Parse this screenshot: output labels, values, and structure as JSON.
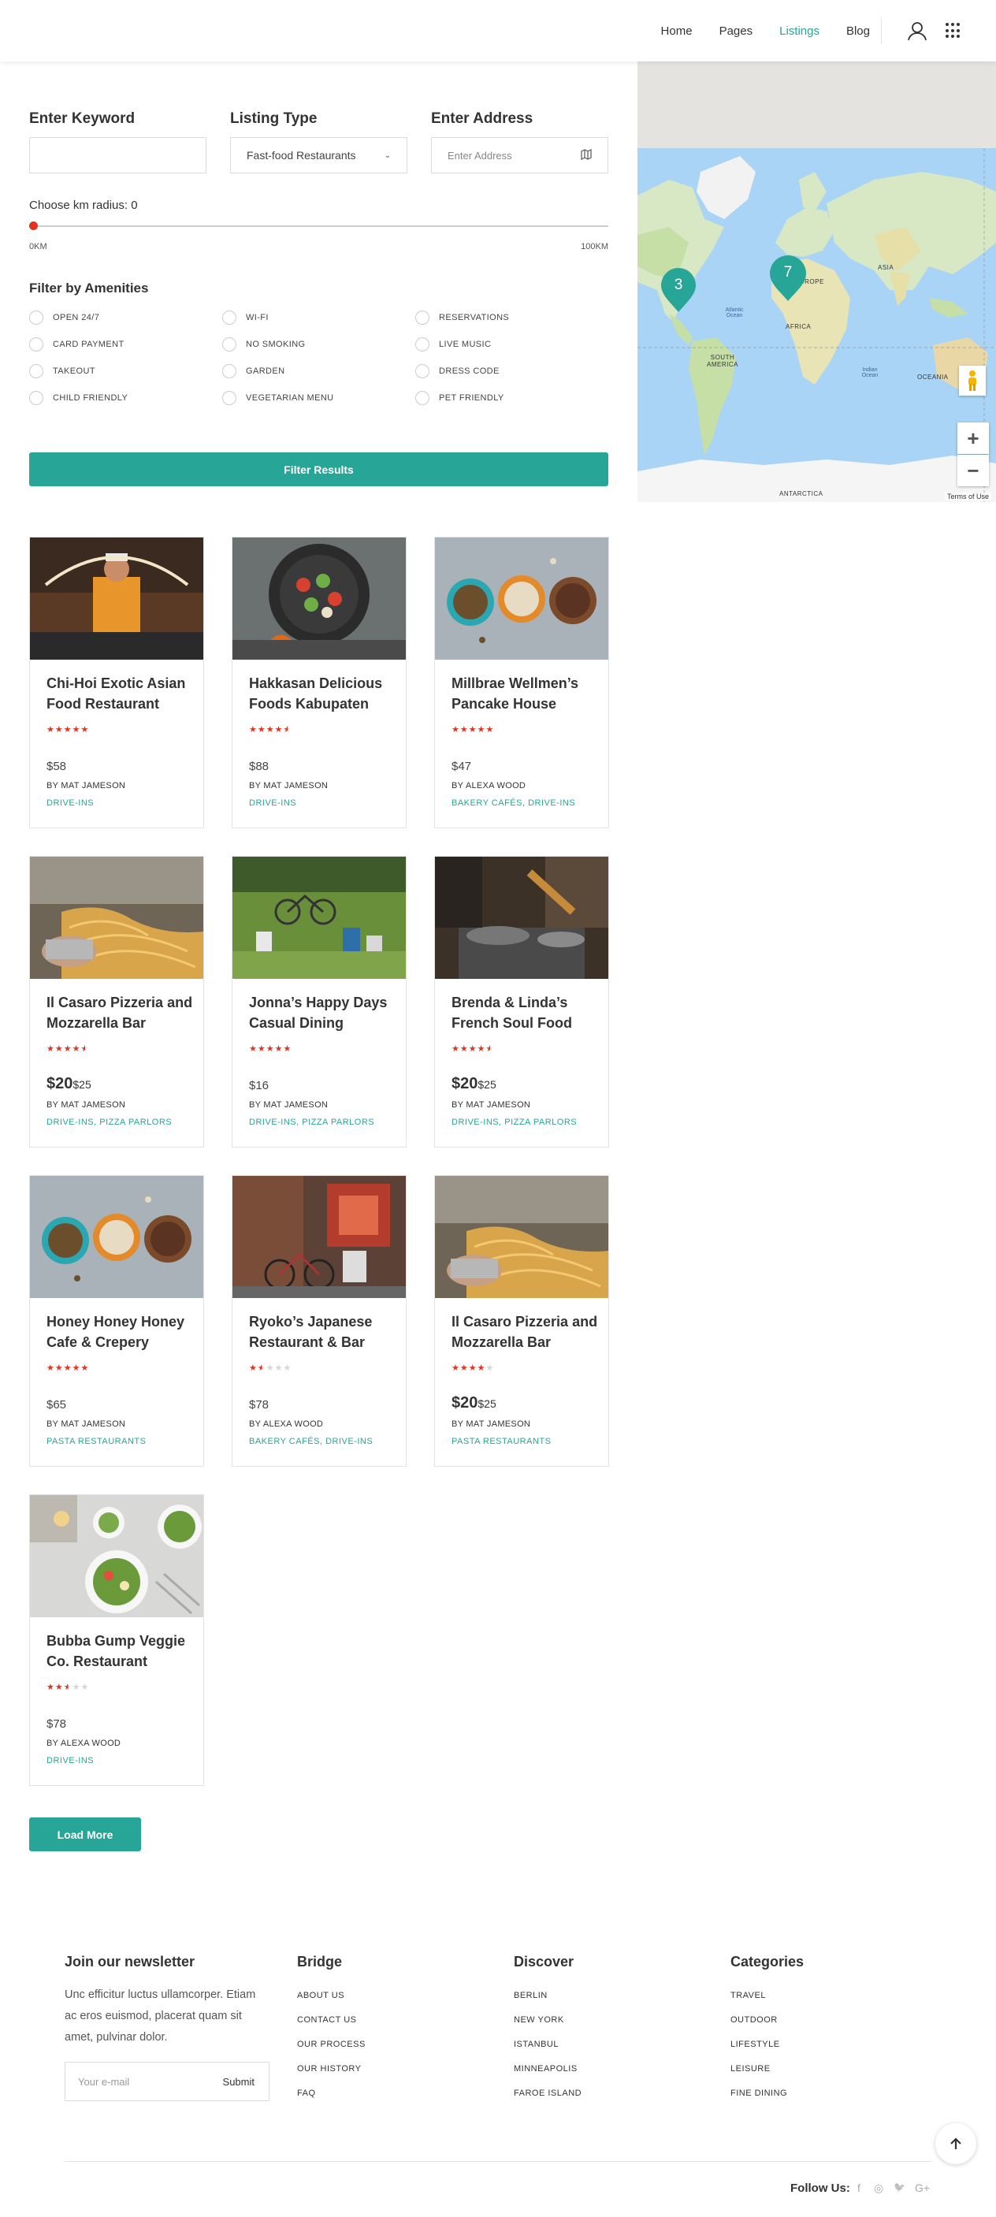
{
  "nav": {
    "items": [
      "Home",
      "Pages",
      "Listings",
      "Blog"
    ],
    "active": "Listings"
  },
  "filters": {
    "keyword_label": "Enter Keyword",
    "keyword_value": "",
    "type_label": "Listing Type",
    "type_value": "Fast-food Restaurants",
    "address_label": "Enter Address",
    "address_placeholder": "Enter Address",
    "radius_label": "Choose km radius: 0",
    "radius_value": 0,
    "radius_min": "0KM",
    "radius_max": "100KM",
    "amenities_title": "Filter by Amenities",
    "amenities": [
      "OPEN 24/7",
      "WI-FI",
      "RESERVATIONS",
      "CARD PAYMENT",
      "NO SMOKING",
      "LIVE MUSIC",
      "TAKEOUT",
      "GARDEN",
      "DRESS CODE",
      "CHILD FRIENDLY",
      "VEGETARIAN MENU",
      "PET FRIENDLY"
    ],
    "submit_label": "Filter Results"
  },
  "map": {
    "clusters": [
      "3",
      "7"
    ],
    "continents": [
      "ASIA",
      "EUROPE",
      "AFRICA",
      "SOUTH AMERICA",
      "OCEANIA",
      "ANTARCTICA"
    ],
    "oceans": [
      "Atlantic Ocean",
      "Indian Ocean"
    ],
    "zoom_in": "+",
    "zoom_out": "−",
    "terms": "Terms of Use"
  },
  "listings": [
    {
      "title": "Chi-Hoi Exotic Asian Food Restaurant",
      "rating": 5,
      "price": "$58",
      "price_sub": "",
      "author": "BY MAT JAMESON",
      "tags": "DRIVE-INS",
      "image": "chef"
    },
    {
      "title": "Hakkasan Delicious Foods Kabupaten",
      "rating": 4.5,
      "price": "$88",
      "price_sub": "",
      "author": "BY MAT JAMESON",
      "tags": "DRIVE-INS",
      "image": "pan"
    },
    {
      "title": "Millbrae Wellmen’s Pancake House",
      "rating": 5,
      "price": "$47",
      "price_sub": "",
      "author": "BY ALEXA WOOD",
      "tags": "BAKERY CAFÉS, DRIVE-INS",
      "image": "bowls"
    },
    {
      "title": "Il Casaro Pizzeria and Mozzarella Bar",
      "rating": 4.5,
      "price": "$20",
      "price_sub": "$25",
      "author": "BY MAT JAMESON",
      "tags": "DRIVE-INS, PIZZA PARLORS",
      "image": "noodles"
    },
    {
      "title": "Jonna’s Happy Days Casual Dining",
      "rating": 5,
      "price": "$16",
      "price_sub": "",
      "author": "BY MAT JAMESON",
      "tags": "DRIVE-INS, PIZZA PARLORS",
      "image": "park"
    },
    {
      "title": "Brenda & Linda’s French Soul Food",
      "rating": 4.5,
      "price": "$20",
      "price_sub": "$25",
      "author": "BY MAT JAMESON",
      "tags": "DRIVE-INS, PIZZA PARLORS",
      "image": "cook"
    },
    {
      "title": "Honey Honey Honey Cafe & Crepery",
      "rating": 5,
      "price": "$65",
      "price_sub": "",
      "author": "BY MAT JAMESON",
      "tags": "PASTA RESTAURANTS",
      "image": "bowls"
    },
    {
      "title": "Ryoko’s Japanese Restaurant & Bar",
      "rating": 1.5,
      "price": "$78",
      "price_sub": "",
      "author": "BY ALEXA WOOD",
      "tags": "BAKERY CAFÉS, DRIVE-INS",
      "image": "street"
    },
    {
      "title": "Il Casaro Pizzeria and Mozzarella Bar",
      "rating": 4,
      "price": "$20",
      "price_sub": "$25",
      "author": "BY MAT JAMESON",
      "tags": "PASTA RESTAURANTS",
      "image": "noodles"
    },
    {
      "title": "Bubba Gump Veggie Co. Restaurant",
      "rating": 2.5,
      "price": "$78",
      "price_sub": "",
      "author": "BY ALEXA WOOD",
      "tags": "DRIVE-INS",
      "image": "salad"
    }
  ],
  "load_more": "Load More",
  "footer": {
    "newsletter_title": "Join our newsletter",
    "newsletter_text": "Unc efficitur luctus ullamcorper. Etiam ac eros euismod, placerat quam sit amet, pulvinar dolor.",
    "email_placeholder": "Your e-mail",
    "submit": "Submit",
    "columns": [
      {
        "title": "Bridge",
        "links": [
          "ABOUT US",
          "CONTACT US",
          "OUR PROCESS",
          "OUR HISTORY",
          "FAQ"
        ]
      },
      {
        "title": "Discover",
        "links": [
          "BERLIN",
          "NEW YORK",
          "ISTANBUL",
          "MINNEAPOLIS",
          "FAROE ISLAND"
        ]
      },
      {
        "title": "Categories",
        "links": [
          "TRAVEL",
          "OUTDOOR",
          "LIFESTYLE",
          "LEISURE",
          "FINE DINING"
        ]
      }
    ],
    "follow_label": "Follow Us:",
    "social": [
      "f",
      "◎",
      "🐦",
      "G+"
    ]
  },
  "colors": {
    "accent": "#27a596",
    "star": "#e2331f"
  }
}
